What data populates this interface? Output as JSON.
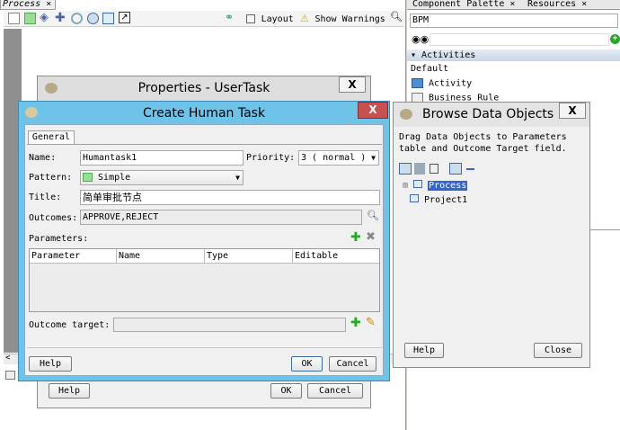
{
  "process_editor": {
    "tab_label": "Process",
    "tab_close": "×",
    "layout_label": "Layout",
    "warnings_label": "Show Warnings",
    "toolbar_icons": [
      "select-icon",
      "task-icon",
      "activity-icon",
      "gateway-icon",
      "event-icon",
      "end-event-icon",
      "subprocess-icon",
      "link-icon"
    ]
  },
  "right_panel": {
    "tab_component_palette": "Component Palette",
    "tab_resources": "Resources",
    "tab_close": "×",
    "palette_select": "BPM",
    "section_activities": "Activities",
    "section_default": "Default",
    "item_activity": "Activity",
    "item_business_rule": "Business Rule"
  },
  "properties_dialog": {
    "title": "Properties - UserTask",
    "close": "X",
    "help": "Help",
    "ok": "OK",
    "cancel": "Cancel"
  },
  "create_dialog": {
    "title": "Create Human Task",
    "close": "X",
    "tab_general": "General",
    "name_label": "Name:",
    "name_value": "Humantask1",
    "priority_label": "Priority:",
    "priority_value": "3 ( normal )",
    "pattern_label": "Pattern:",
    "pattern_value": "Simple",
    "title_label": "Title:",
    "title_value": "简单审批节点",
    "outcomes_label": "Outcomes:",
    "outcomes_value": "APPROVE,REJECT",
    "parameters_label": "Parameters:",
    "table_headers": [
      "Parameter",
      "Name",
      "Type",
      "Editable"
    ],
    "outcome_target_label": "Outcome target:",
    "help": "Help",
    "ok": "OK",
    "cancel": "Cancel"
  },
  "browse_dialog": {
    "title": "Browse Data Objects",
    "close": "X",
    "description": "Drag Data Objects to Parameters table and Outcome Target field.",
    "tree_items": [
      "Process",
      "Project1"
    ],
    "help": "Help",
    "close_button": "Close"
  },
  "colors": {
    "dialog_active_border": "#6fc3e8",
    "close_red": "#c75050",
    "selection": "#3366cc"
  }
}
